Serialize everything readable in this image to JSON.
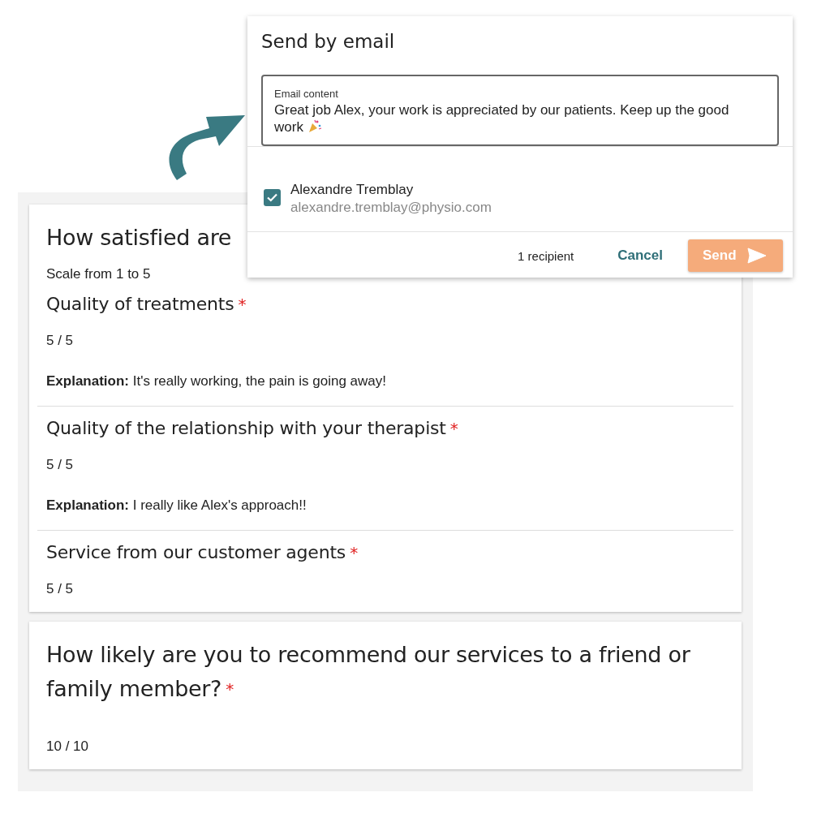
{
  "survey": {
    "cards": [
      {
        "title": "How satisfied are",
        "subtitle": "Scale from 1 to 5",
        "questions": [
          {
            "title": "Quality of treatments",
            "required_mark": "*",
            "answer": "5 / 5",
            "explanation": "**Explanation:** It's really working, the pain is going away!"
          },
          {
            "title": "Quality of the relationship with your therapist",
            "required_mark": "*",
            "answer": "5 / 5",
            "explanation": "**Explanation:** I really like Alex's approach!!"
          },
          {
            "title": "Service from our customer agents",
            "required_mark": "*",
            "answer": "5 / 5"
          }
        ]
      },
      {
        "title": "How likely are you to recommend our services to a friend or family member?",
        "required_mark": "*",
        "questions": [
          {
            "answer": "10 / 10"
          }
        ]
      }
    ]
  },
  "email_dialog": {
    "title": "Send by email",
    "field": {
      "label": "Email content",
      "value": "Great job Alex, your work is appreciated by our patients. Keep up the good work"
    },
    "recipients": [
      {
        "name": "Alexandre Tremblay",
        "email": "alexandre.tremblay@physio.com",
        "checked": true
      }
    ],
    "recipient_count": "1 recipient",
    "cancel": "Cancel",
    "send": "Send"
  }
}
